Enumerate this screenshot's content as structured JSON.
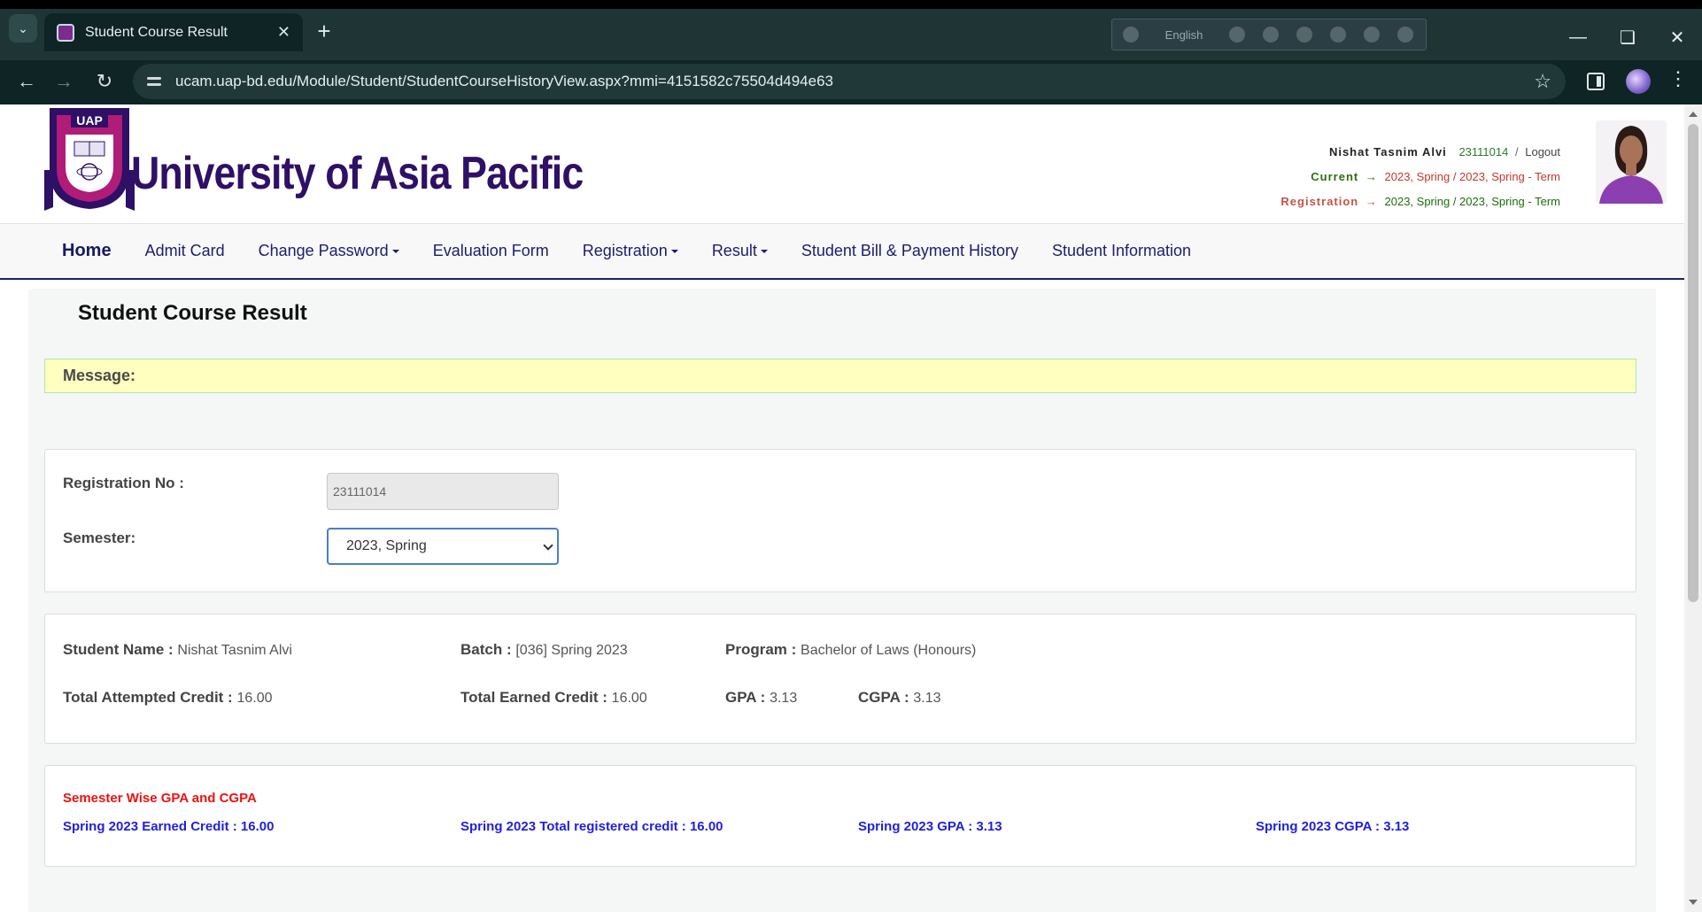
{
  "browser": {
    "tab_title": "Student Course Result",
    "url": "ucam.uap-bd.edu/Module/Student/StudentCourseHistoryView.aspx?mmi=4151582c75504d494e63",
    "extension_language": "English"
  },
  "header": {
    "university_name": "University of Asia Pacific",
    "seal_text": "UAP",
    "seal_ring_text": "UNIVERSITY OF ASIA PACIFIC",
    "user_name": "Nishat  Tasnim  Alvi",
    "user_id": "23111014",
    "separator": "/",
    "logout_label": "Logout",
    "current_label": "Current",
    "current_value": "2023, Spring / 2023, Spring - Term",
    "registration_label": "Registration",
    "registration_value": "2023, Spring / 2023, Spring - Term"
  },
  "nav": {
    "items": [
      {
        "label": "Home"
      },
      {
        "label": "Admit Card"
      },
      {
        "label": "Change Password"
      },
      {
        "label": "Evaluation Form"
      },
      {
        "label": "Registration"
      },
      {
        "label": "Result"
      },
      {
        "label": "Student Bill & Payment History"
      },
      {
        "label": "Student Information"
      }
    ]
  },
  "page": {
    "title": "Student Course Result",
    "message_label": "Message:"
  },
  "form": {
    "registration_label": "Registration No :",
    "registration_value": "23111014",
    "semester_label": "Semester:",
    "semester_value": "2023, Spring"
  },
  "student_info": {
    "name_label": "Student Name :",
    "name_value": "Nishat Tasnim Alvi",
    "batch_label": "Batch :",
    "batch_value": "[036] Spring 2023",
    "program_label": "Program :",
    "program_value": "Bachelor of Laws (Honours)",
    "attempted_label": "Total Attempted Credit :",
    "attempted_value": "16.00",
    "earned_label": "Total Earned Credit :",
    "earned_value": "16.00",
    "gpa_label": "GPA :",
    "gpa_value": "3.13",
    "cgpa_label": "CGPA :",
    "cgpa_value": "3.13"
  },
  "semester_wise": {
    "heading": "Semester Wise GPA and CGPA",
    "earned_credit": "Spring 2023 Earned Credit : 16.00",
    "registered_credit": "Spring 2023 Total registered credit : 16.00",
    "gpa": "Spring 2023 GPA : 3.13",
    "cgpa": "Spring 2023 CGPA : 3.13"
  },
  "colors": {
    "brand_purple": "#2e1066",
    "nav_text": "#1b1e6e",
    "message_bg": "#ffffc0",
    "semester_heading": "#ee1111",
    "semester_stats": "#1f1fe0"
  }
}
